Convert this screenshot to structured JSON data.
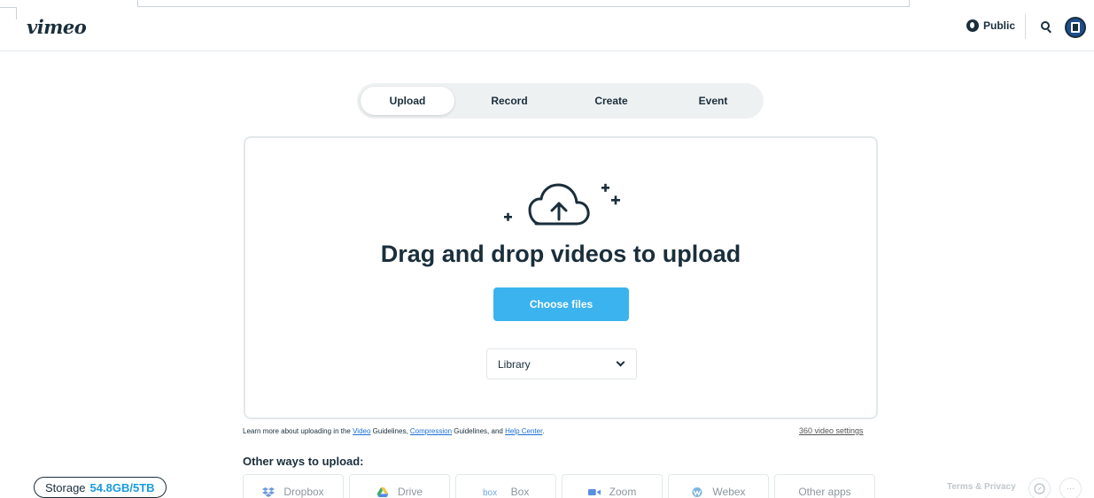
{
  "header": {
    "logo": "vimeo",
    "public_label": "Public"
  },
  "tabs": [
    {
      "label": "Upload",
      "active": true
    },
    {
      "label": "Record",
      "active": false
    },
    {
      "label": "Create",
      "active": false
    },
    {
      "label": "Event",
      "active": false
    }
  ],
  "dropzone": {
    "title": "Drag and drop videos to upload",
    "choose_label": "Choose files",
    "destination_value": "Library"
  },
  "learn_more": {
    "prefix": "Learn more about uploading in the ",
    "link_video": "Video",
    "text_guidelines_1": " Guidelines, ",
    "link_compression": "Compression",
    "text_guidelines_2": " Guidelines, and ",
    "link_help": "Help Center",
    "suffix": "."
  },
  "video_360_link": "360 video settings",
  "other_ways": {
    "title": "Other ways to upload:",
    "items": [
      {
        "label": "Dropbox",
        "icon": "dropbox-icon"
      },
      {
        "label": "Drive",
        "icon": "drive-icon"
      },
      {
        "label": "Box",
        "icon": "box-icon"
      },
      {
        "label": "Zoom",
        "icon": "zoom-icon"
      },
      {
        "label": "Webex",
        "icon": "webex-icon"
      },
      {
        "label": "Other apps",
        "icon": ""
      }
    ]
  },
  "storage": {
    "label": "Storage",
    "value": "54.8GB/5TB"
  },
  "footer": {
    "terms_label": "Terms & Privacy",
    "more_label": "···"
  },
  "colors": {
    "accent": "#3bb3ee",
    "text": "#1a2e3b",
    "link": "#1a6fd6",
    "storage_value": "#1a9cdf"
  }
}
